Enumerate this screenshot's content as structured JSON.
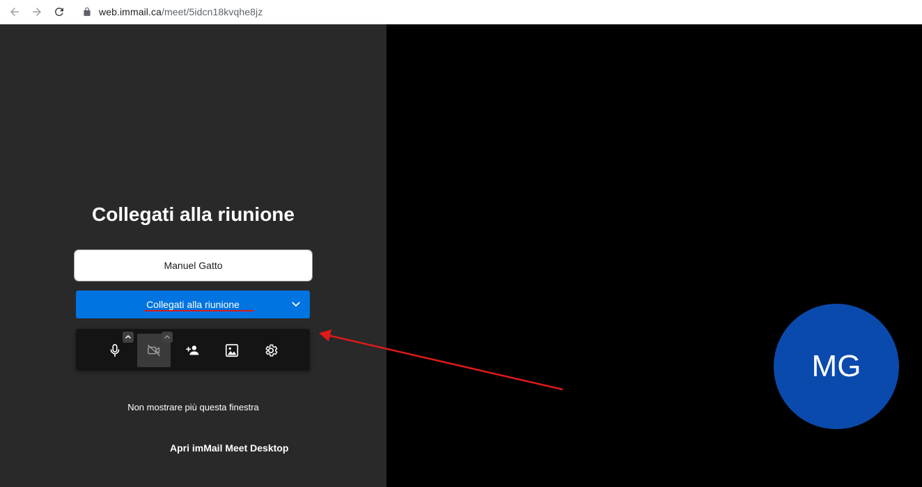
{
  "browser": {
    "url_host": "web.immail.ca",
    "url_path": "/meet/5idcn18kvqhe8jz"
  },
  "prejoin": {
    "title": "Collegati alla riunione",
    "name_value": "Manuel Gatto",
    "join_button_label": "Collegati alla riunione",
    "dont_show_label": "Non mostrare più questa finestra",
    "desktop_link_label": "Apri imMail Meet Desktop"
  },
  "toolbar": {
    "items": [
      {
        "icon": "microphone-icon"
      },
      {
        "icon": "camera-off-icon",
        "state": "active"
      },
      {
        "icon": "invite-person-icon"
      },
      {
        "icon": "background-image-icon"
      },
      {
        "icon": "settings-gear-icon"
      }
    ]
  },
  "video_preview": {
    "avatar_initials": "MG",
    "avatar_color": "#0b4aad"
  },
  "colors": {
    "left_pane": "#292929",
    "right_pane": "#000000",
    "accent": "#0074e0",
    "annotation": "#e01a1a"
  }
}
